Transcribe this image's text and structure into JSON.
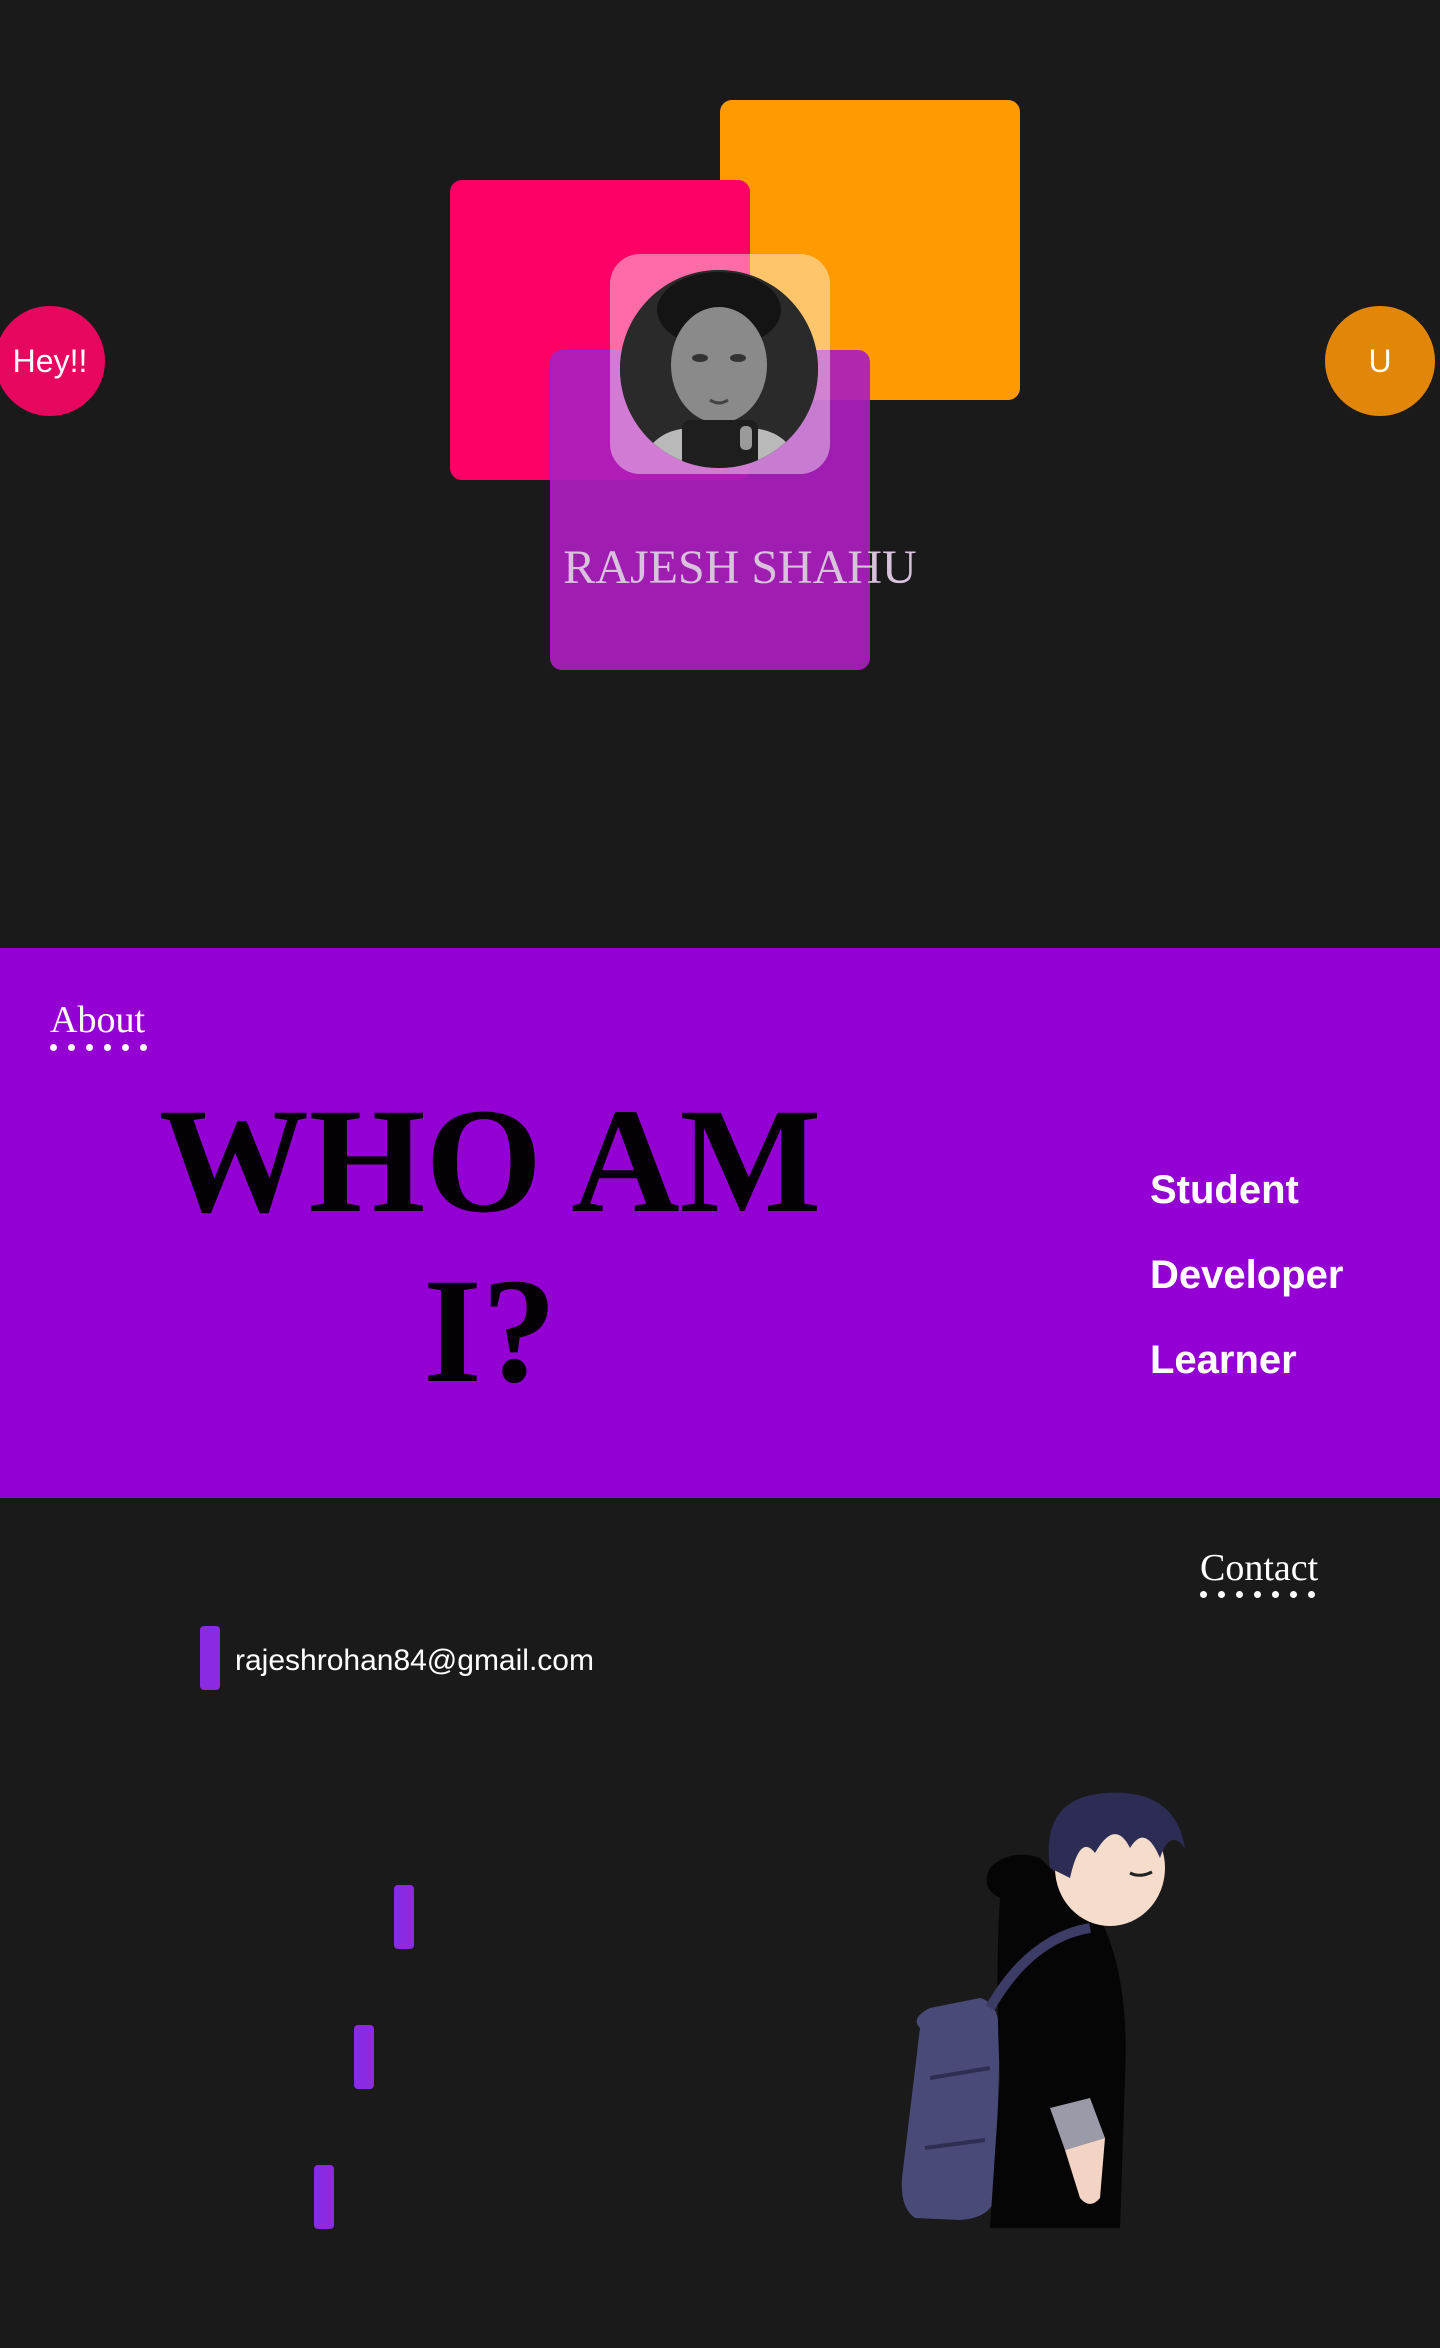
{
  "hero": {
    "name": "RAJESH SHAHU",
    "greeting_bubble": "Hey!!",
    "user_bubble": "U",
    "photo_alt": "profile photo"
  },
  "about": {
    "label": "About",
    "title_line1": "WHO AM",
    "title_line2": "I?",
    "roles": [
      "Student",
      "Developer",
      "Learner"
    ]
  },
  "contact": {
    "label": "Contact",
    "email": "rajeshrohan84@gmail.com"
  },
  "colors": {
    "background": "#1a1a1a",
    "orange": "#ff9b00",
    "pink": "#ff0066",
    "purple": "#9400d3",
    "accent_bar": "#8a2be2"
  }
}
